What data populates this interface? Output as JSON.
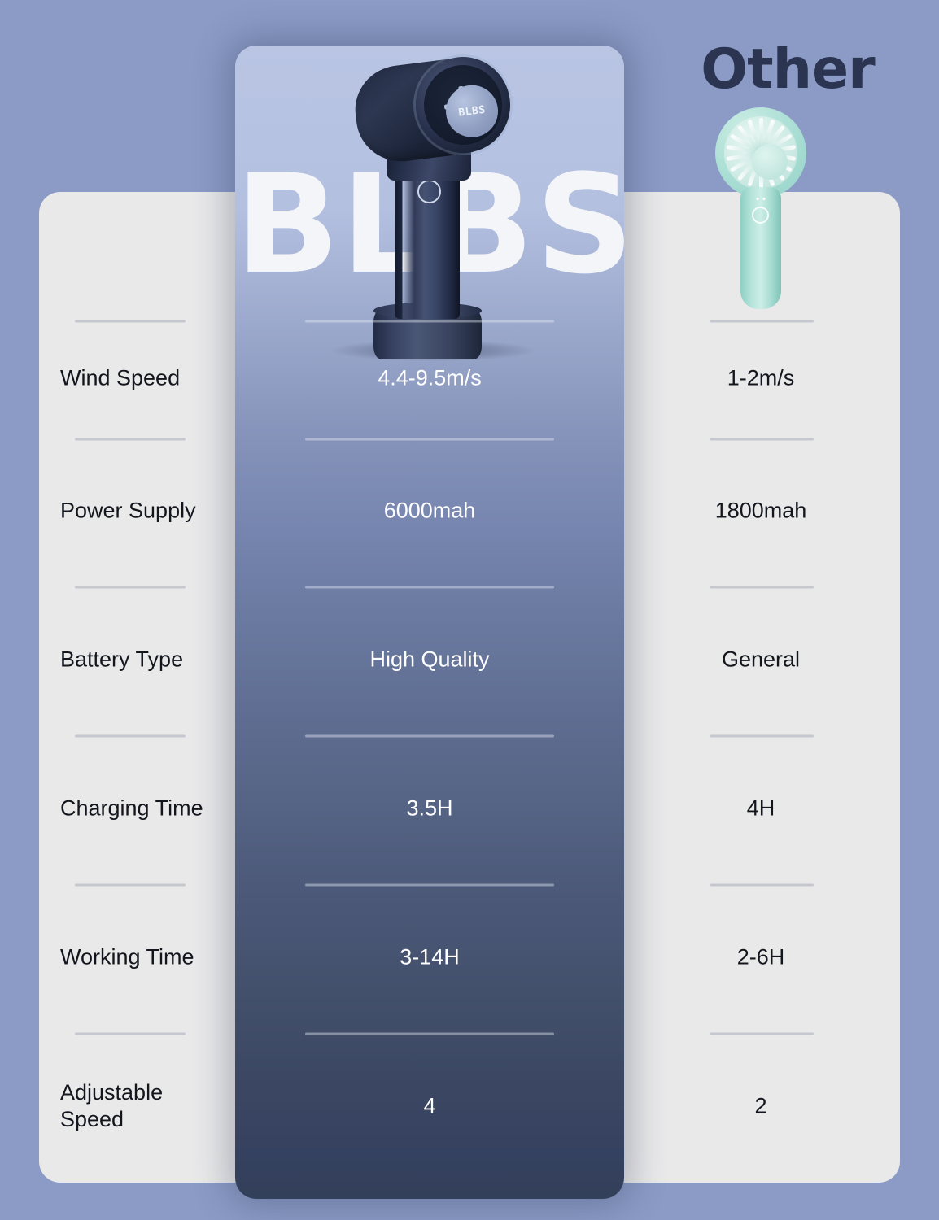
{
  "theme": {
    "background": "#8b9bc6",
    "spec_card_bg": "#e9e9ea",
    "hero_gradient_top": "#b9c5e3",
    "hero_gradient_bottom": "#334059",
    "label_text": "#13161d",
    "hero_text": "#ffffff",
    "divider": "#c5c8cf",
    "other_title_color": "#2b3450",
    "other_product_color": "#aee0d6"
  },
  "hero": {
    "watermark": "BLBS",
    "product_name": "BLBS handheld fan",
    "hub_logo": "BLBS"
  },
  "other": {
    "title": "Other",
    "product_name": "generic mint handheld fan"
  },
  "comparison": {
    "rows": [
      {
        "label": "Wind Speed",
        "blbs": "4.4-9.5m/s",
        "other": "1-2m/s"
      },
      {
        "label": "Power Supply",
        "blbs": "6000mah",
        "other": "1800mah"
      },
      {
        "label": "Battery Type",
        "blbs": "High Quality",
        "other": "General"
      },
      {
        "label": "Charging Time",
        "blbs": "3.5H",
        "other": "4H"
      },
      {
        "label": "Working Time",
        "blbs": "3-14H",
        "other": "2-6H"
      },
      {
        "label": "Adjustable\nSpeed",
        "blbs": "4",
        "other": "2"
      }
    ]
  }
}
